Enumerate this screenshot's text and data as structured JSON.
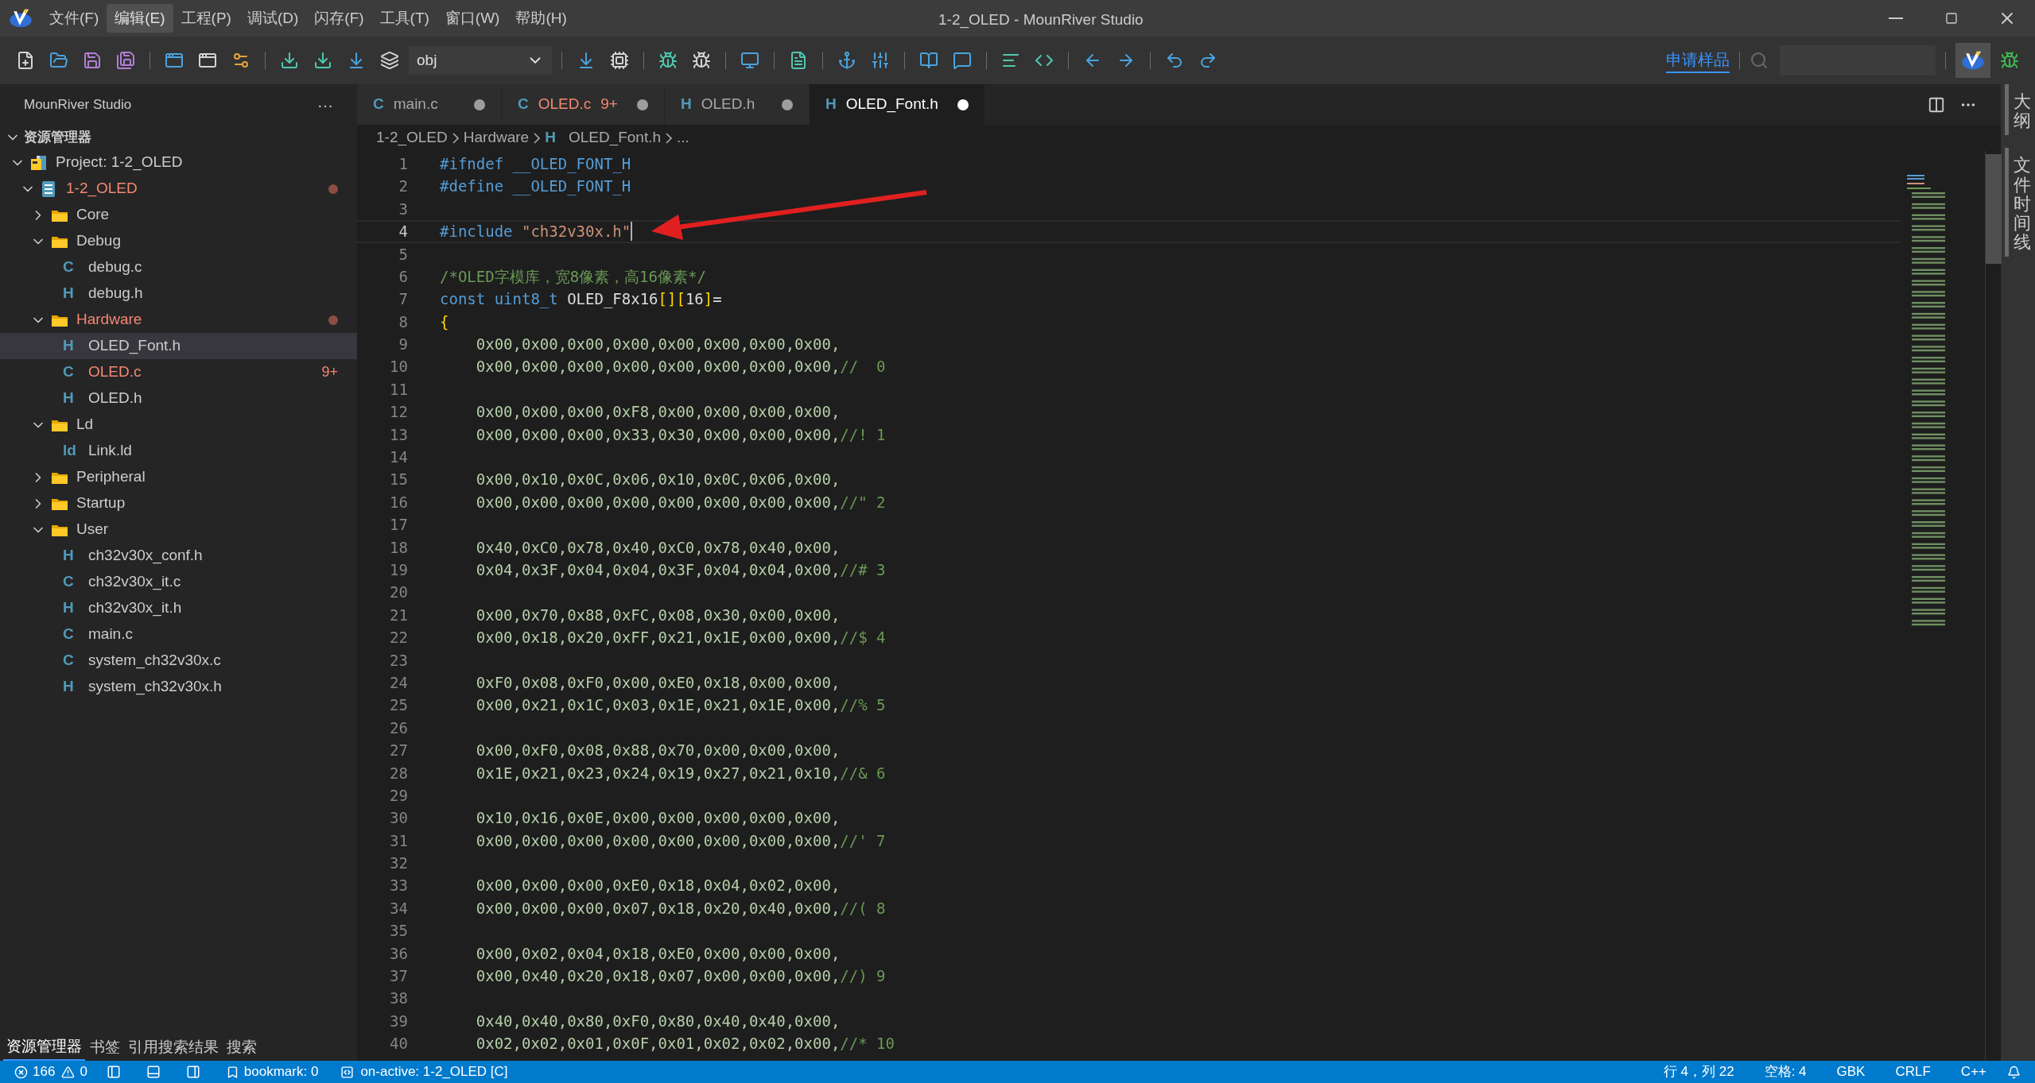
{
  "window": {
    "title": "1-2_OLED - MounRiver Studio"
  },
  "menu": [
    {
      "label": "文件(F)",
      "selected": false
    },
    {
      "label": "编辑(E)",
      "selected": true
    },
    {
      "label": "工程(P)",
      "selected": false
    },
    {
      "label": "调试(D)",
      "selected": false
    },
    {
      "label": "闪存(F)",
      "selected": false
    },
    {
      "label": "工具(T)",
      "selected": false
    },
    {
      "label": "窗口(W)",
      "selected": false
    },
    {
      "label": "帮助(H)",
      "selected": false
    }
  ],
  "toolbar": {
    "config_select": {
      "value": "obj"
    },
    "sample_link": "申请样品"
  },
  "sidebar": {
    "title": "MounRiver Studio",
    "more": "···",
    "section": {
      "label": "资源管理器",
      "expanded": true
    },
    "tree": [
      {
        "kind": "project",
        "label": "Project: 1-2_OLED",
        "expanded": true,
        "children": [
          {
            "kind": "module",
            "label": "1-2_OLED",
            "expanded": true,
            "problem": true,
            "dot": true,
            "children": [
              {
                "kind": "folder",
                "label": "Core",
                "expanded": false
              },
              {
                "kind": "folder",
                "label": "Debug",
                "expanded": true,
                "children": [
                  {
                    "kind": "file",
                    "icon": "C",
                    "label": "debug.c",
                    "selected": false
                  },
                  {
                    "kind": "file",
                    "icon": "H",
                    "label": "debug.h",
                    "selected": false
                  }
                ]
              },
              {
                "kind": "folder",
                "label": "Hardware",
                "expanded": true,
                "problem": true,
                "dot": true,
                "children": [
                  {
                    "kind": "file",
                    "icon": "H",
                    "label": "OLED_Font.h",
                    "selected": true
                  },
                  {
                    "kind": "file",
                    "icon": "C",
                    "label": "OLED.c",
                    "selected": false,
                    "problem": true,
                    "badge": "9+"
                  },
                  {
                    "kind": "file",
                    "icon": "H",
                    "label": "OLED.h",
                    "selected": false
                  }
                ]
              },
              {
                "kind": "folder",
                "label": "Ld",
                "expanded": true,
                "children": [
                  {
                    "kind": "file",
                    "icon": "ld",
                    "label": "Link.ld",
                    "selected": false
                  }
                ]
              },
              {
                "kind": "folder",
                "label": "Peripheral",
                "expanded": false
              },
              {
                "kind": "folder",
                "label": "Startup",
                "expanded": false
              },
              {
                "kind": "folder",
                "label": "User",
                "expanded": true,
                "children": [
                  {
                    "kind": "file",
                    "icon": "H",
                    "label": "ch32v30x_conf.h",
                    "selected": false
                  },
                  {
                    "kind": "file",
                    "icon": "C",
                    "label": "ch32v30x_it.c",
                    "selected": false
                  },
                  {
                    "kind": "file",
                    "icon": "H",
                    "label": "ch32v30x_it.h",
                    "selected": false
                  },
                  {
                    "kind": "file",
                    "icon": "C",
                    "label": "main.c",
                    "selected": false
                  },
                  {
                    "kind": "file",
                    "icon": "C",
                    "label": "system_ch32v30x.c",
                    "selected": false
                  },
                  {
                    "kind": "file",
                    "icon": "H",
                    "label": "system_ch32v30x.h",
                    "selected": false
                  }
                ]
              }
            ]
          }
        ]
      }
    ],
    "bottom_tabs": [
      {
        "label": "资源管理器",
        "selected": true
      },
      {
        "label": "书签",
        "selected": false
      },
      {
        "label": "引用搜索结果",
        "selected": false
      },
      {
        "label": "搜索",
        "selected": false
      }
    ]
  },
  "tabs": [
    {
      "icon": "C",
      "label": "main.c",
      "selected": false,
      "modified": true
    },
    {
      "icon": "C",
      "label": "OLED.c",
      "badge": "9+",
      "problem": true,
      "selected": false,
      "modified": true
    },
    {
      "icon": "H",
      "label": "OLED.h",
      "selected": false,
      "modified": true
    },
    {
      "icon": "H",
      "label": "OLED_Font.h",
      "selected": true,
      "modified": true
    }
  ],
  "breadcrumb": {
    "parts": [
      "1-2_OLED",
      "Hardware"
    ],
    "file_icon": "H",
    "file": "OLED_Font.h",
    "more": "..."
  },
  "editor": {
    "lines": [
      {
        "n": "1",
        "tokens": [
          {
            "kind": "pp",
            "text": "#ifndef __OLED_FONT_H"
          }
        ]
      },
      {
        "n": "2",
        "tokens": [
          {
            "kind": "pp",
            "text": "#define __OLED_FONT_H"
          }
        ]
      },
      {
        "n": "3"
      },
      {
        "n": "4",
        "current": true,
        "tokens": [
          {
            "kind": "pp",
            "text": "#include "
          },
          {
            "kind": "str",
            "text": "\"ch32v30x.h\""
          }
        ]
      },
      {
        "n": "5"
      },
      {
        "n": "6",
        "tokens": [
          {
            "kind": "cmt",
            "text": "/*OLED字模库，宽8像素，高16像素*/"
          }
        ]
      },
      {
        "n": "7",
        "tokens": [
          {
            "kind": "kw",
            "text": "const uint8_t"
          },
          {
            "kind": "id",
            "text": " OLED_F8x16"
          },
          {
            "kind": "br",
            "text": "[]["
          },
          {
            "kind": "id",
            "text": "16"
          },
          {
            "kind": "br",
            "text": "]"
          },
          {
            "kind": "id",
            "text": "="
          }
        ]
      },
      {
        "n": "8",
        "tokens": [
          {
            "kind": "br",
            "text": "{"
          }
        ]
      },
      {
        "n": "9",
        "tokens": [
          {
            "kind": "num",
            "text": "    0x00,0x00,0x00,0x00,0x00,0x00,0x00,0x00,"
          }
        ]
      },
      {
        "n": "10",
        "tokens": [
          {
            "kind": "num",
            "text": "    0x00,0x00,0x00,0x00,0x00,0x00,0x00,0x00,"
          },
          {
            "kind": "cmt",
            "text": "//  0"
          }
        ]
      },
      {
        "n": "11"
      },
      {
        "n": "12",
        "tokens": [
          {
            "kind": "num",
            "text": "    0x00,0x00,0x00,0xF8,0x00,0x00,0x00,0x00,"
          }
        ]
      },
      {
        "n": "13",
        "tokens": [
          {
            "kind": "num",
            "text": "    0x00,0x00,0x00,0x33,0x30,0x00,0x00,0x00,"
          },
          {
            "kind": "cmt",
            "text": "//! 1"
          }
        ]
      },
      {
        "n": "14"
      },
      {
        "n": "15",
        "tokens": [
          {
            "kind": "num",
            "text": "    0x00,0x10,0x0C,0x06,0x10,0x0C,0x06,0x00,"
          }
        ]
      },
      {
        "n": "16",
        "tokens": [
          {
            "kind": "num",
            "text": "    0x00,0x00,0x00,0x00,0x00,0x00,0x00,0x00,"
          },
          {
            "kind": "cmt",
            "text": "//\" 2"
          }
        ]
      },
      {
        "n": "17"
      },
      {
        "n": "18",
        "tokens": [
          {
            "kind": "num",
            "text": "    0x40,0xC0,0x78,0x40,0xC0,0x78,0x40,0x00,"
          }
        ]
      },
      {
        "n": "19",
        "tokens": [
          {
            "kind": "num",
            "text": "    0x04,0x3F,0x04,0x04,0x3F,0x04,0x04,0x00,"
          },
          {
            "kind": "cmt",
            "text": "//# 3"
          }
        ]
      },
      {
        "n": "20"
      },
      {
        "n": "21",
        "tokens": [
          {
            "kind": "num",
            "text": "    0x00,0x70,0x88,0xFC,0x08,0x30,0x00,0x00,"
          }
        ]
      },
      {
        "n": "22",
        "tokens": [
          {
            "kind": "num",
            "text": "    0x00,0x18,0x20,0xFF,0x21,0x1E,0x00,0x00,"
          },
          {
            "kind": "cmt",
            "text": "//$ 4"
          }
        ]
      },
      {
        "n": "23"
      },
      {
        "n": "24",
        "tokens": [
          {
            "kind": "num",
            "text": "    0xF0,0x08,0xF0,0x00,0xE0,0x18,0x00,0x00,"
          }
        ]
      },
      {
        "n": "25",
        "tokens": [
          {
            "kind": "num",
            "text": "    0x00,0x21,0x1C,0x03,0x1E,0x21,0x1E,0x00,"
          },
          {
            "kind": "cmt",
            "text": "//% 5"
          }
        ]
      },
      {
        "n": "26"
      },
      {
        "n": "27",
        "tokens": [
          {
            "kind": "num",
            "text": "    0x00,0xF0,0x08,0x88,0x70,0x00,0x00,0x00,"
          }
        ]
      },
      {
        "n": "28",
        "tokens": [
          {
            "kind": "num",
            "text": "    0x1E,0x21,0x23,0x24,0x19,0x27,0x21,0x10,"
          },
          {
            "kind": "cmt",
            "text": "//& 6"
          }
        ]
      },
      {
        "n": "29"
      },
      {
        "n": "30",
        "tokens": [
          {
            "kind": "num",
            "text": "    0x10,0x16,0x0E,0x00,0x00,0x00,0x00,0x00,"
          }
        ]
      },
      {
        "n": "31",
        "tokens": [
          {
            "kind": "num",
            "text": "    0x00,0x00,0x00,0x00,0x00,0x00,0x00,0x00,"
          },
          {
            "kind": "cmt",
            "text": "//' 7"
          }
        ]
      },
      {
        "n": "32"
      },
      {
        "n": "33",
        "tokens": [
          {
            "kind": "num",
            "text": "    0x00,0x00,0x00,0xE0,0x18,0x04,0x02,0x00,"
          }
        ]
      },
      {
        "n": "34",
        "tokens": [
          {
            "kind": "num",
            "text": "    0x00,0x00,0x00,0x07,0x18,0x20,0x40,0x00,"
          },
          {
            "kind": "cmt",
            "text": "//( 8"
          }
        ]
      },
      {
        "n": "35"
      },
      {
        "n": "36",
        "tokens": [
          {
            "kind": "num",
            "text": "    0x00,0x02,0x04,0x18,0xE0,0x00,0x00,0x00,"
          }
        ]
      },
      {
        "n": "37",
        "tokens": [
          {
            "kind": "num",
            "text": "    0x00,0x40,0x20,0x18,0x07,0x00,0x00,0x00,"
          },
          {
            "kind": "cmt",
            "text": "//) 9"
          }
        ]
      },
      {
        "n": "38"
      },
      {
        "n": "39",
        "tokens": [
          {
            "kind": "num",
            "text": "    0x40,0x40,0x80,0xF0,0x80,0x40,0x40,0x00,"
          }
        ]
      },
      {
        "n": "40",
        "tokens": [
          {
            "kind": "num",
            "text": "    0x02,0x02,0x01,0x0F,0x01,0x02,0x02,0x00,"
          },
          {
            "kind": "cmt",
            "text": "//* 10"
          }
        ]
      }
    ]
  },
  "activity_bar": [
    {
      "label": "大纲"
    },
    {
      "label": "文件时间线"
    }
  ],
  "status_bar": {
    "errors": "166",
    "warnings": "0",
    "bookmark": "bookmark: 0",
    "active": "on-active: 1-2_OLED [C]",
    "right": [
      "行 4，列 22",
      "空格: 4",
      "GBK",
      "CRLF",
      "C++"
    ]
  }
}
